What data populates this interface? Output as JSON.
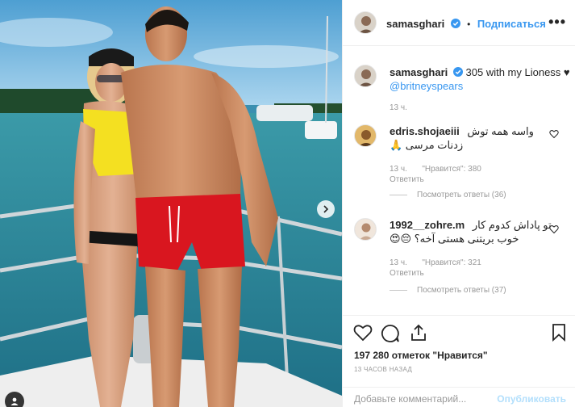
{
  "post": {
    "author": "samasghari",
    "follow_label": "Подписаться",
    "dot": "•",
    "more_label": "•••",
    "caption_text": "305 with my Lioness ♥",
    "caption_mention": "@britneyspears",
    "caption_time": "13 ч."
  },
  "comments": [
    {
      "user": "edris.shojaeiii",
      "line1": "واسه همه توش",
      "line2": "زدنات مرسی 🙏",
      "time": "13 ч.",
      "likes": "\"Нравится\": 380",
      "reply": "Ответить",
      "view_replies": "Посмотреть ответы (36)"
    },
    {
      "user": "1992__zohre.m",
      "line1": "تو پاداش کدوم کار",
      "line2": "خوب بریتنی هستی آخه؟ 😔😍",
      "time": "13 ч.",
      "likes": "\"Нравится\": 321",
      "reply": "Ответить",
      "view_replies": "Посмотреть ответы (37)"
    }
  ],
  "actions": {
    "likes_text": "197 280 отметок \"Нравится\"",
    "time_ago": "13 ЧАСОВ НАЗАД"
  },
  "comment_box": {
    "placeholder": "Добавьте комментарий...",
    "publish_label": "Опубликовать"
  },
  "icons": {
    "heart": "heart-icon",
    "comment": "comment-icon",
    "share": "share-icon",
    "bookmark": "bookmark-icon",
    "verified": "verified-badge-icon",
    "next": "chevron-right-icon",
    "tag": "user-tag-icon"
  },
  "colors": {
    "link": "#3897f0",
    "verified": "#3897f0",
    "muted": "#999999"
  }
}
